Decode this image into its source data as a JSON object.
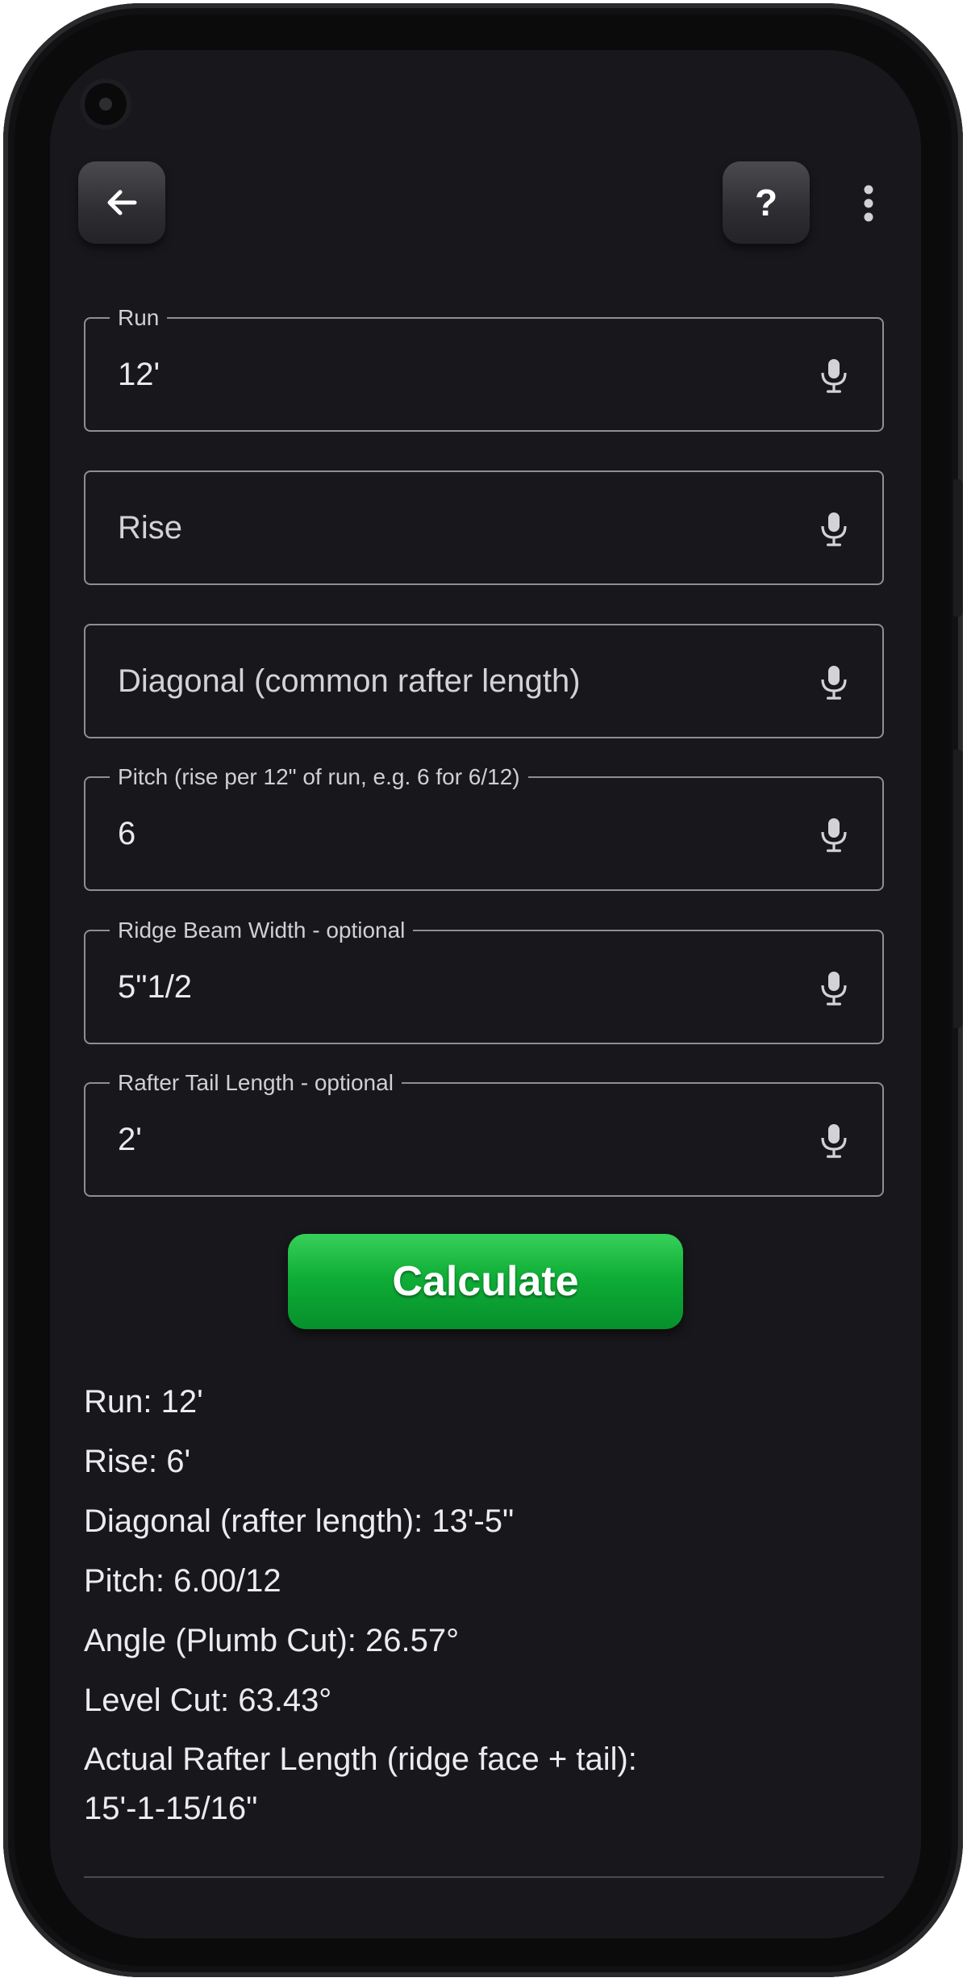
{
  "header": {
    "back_icon": "arrow-left-icon",
    "help_label": "?",
    "more_icon": "more-vert-icon"
  },
  "fields": {
    "run": {
      "label": "Run",
      "value": "12'"
    },
    "rise": {
      "placeholder": "Rise"
    },
    "diagonal": {
      "placeholder": "Diagonal (common rafter length)"
    },
    "pitch": {
      "label": "Pitch (rise per 12\" of run, e.g. 6 for 6/12)",
      "value": "6"
    },
    "ridge": {
      "label": "Ridge Beam Width - optional",
      "value": "5\"1/2"
    },
    "tail": {
      "label": "Rafter Tail Length - optional",
      "value": "2'"
    }
  },
  "calculate_label": "Calculate",
  "results": [
    "Run: 12'",
    "Rise: 6'",
    "Diagonal (rafter length): 13'-5\"",
    "Pitch: 6.00/12",
    "Angle (Plumb Cut): 26.57°",
    "Level Cut: 63.43°",
    "Actual Rafter Length (ridge face + tail): 15'-1-15/16\""
  ],
  "colors": {
    "background": "#18181c",
    "accent_green": "#0fae37",
    "outline": "#8e8e93"
  }
}
